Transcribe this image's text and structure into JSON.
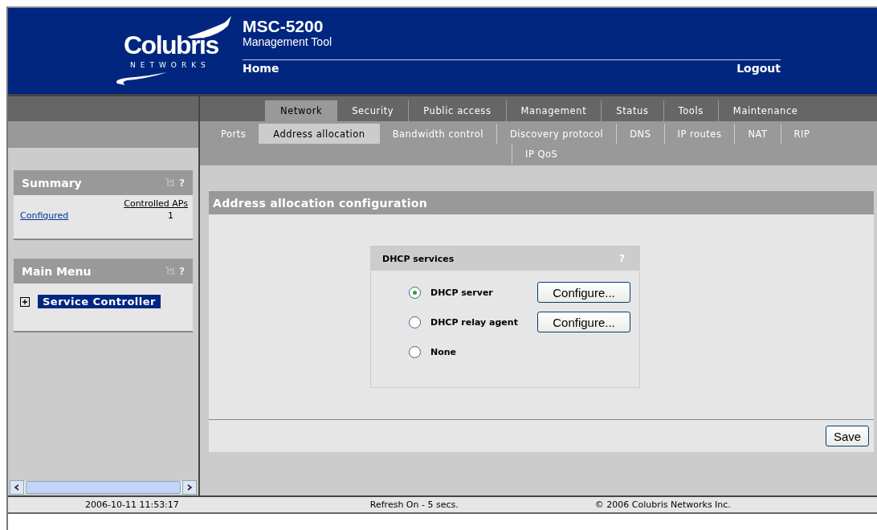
{
  "header": {
    "logo_name": "Colubris",
    "logo_tagline": "NETWORKS",
    "product": "MSC-5200",
    "subtitle": "Management Tool",
    "home": "Home",
    "logout": "Logout"
  },
  "tabs": [
    {
      "label": "Network",
      "selected": true
    },
    {
      "label": "Security",
      "selected": false
    },
    {
      "label": "Public access",
      "selected": false
    },
    {
      "label": "Management",
      "selected": false
    },
    {
      "label": "Status",
      "selected": false
    },
    {
      "label": "Tools",
      "selected": false
    },
    {
      "label": "Maintenance",
      "selected": false
    }
  ],
  "subtab_rows": [
    [
      {
        "label": "Ports",
        "selected": false
      },
      {
        "label": "Address allocation",
        "selected": true
      },
      {
        "label": "Bandwidth control",
        "selected": false
      },
      {
        "label": "Discovery protocol",
        "selected": false
      },
      {
        "label": "DNS",
        "selected": false
      },
      {
        "label": "IP routes",
        "selected": false
      },
      {
        "label": "NAT",
        "selected": false
      },
      {
        "label": "RIP",
        "selected": false
      }
    ],
    [
      {
        "label": "IP QoS",
        "selected": false
      }
    ]
  ],
  "sidebar": {
    "summary": {
      "title": "Summary",
      "help": "?",
      "column_header": "Controlled APs",
      "rows": [
        {
          "label": "Configured",
          "value": "1"
        }
      ]
    },
    "main_menu": {
      "title": "Main Menu",
      "help": "?",
      "items": [
        {
          "label": "Service Controller",
          "expanded": false,
          "selected": true
        }
      ]
    }
  },
  "content": {
    "title": "Address allocation configuration",
    "dhcp": {
      "title": "DHCP services",
      "help": "?",
      "options": [
        {
          "label": "DHCP server",
          "selected": true,
          "button": "Configure..."
        },
        {
          "label": "DHCP relay agent",
          "selected": false,
          "button": "Configure..."
        },
        {
          "label": "None",
          "selected": false
        }
      ]
    },
    "save": "Save"
  },
  "status_bar": [
    "2006-10-11 11:53:17",
    "Refresh On - 5 secs.",
    "© 2006 Colubris Networks Inc."
  ]
}
